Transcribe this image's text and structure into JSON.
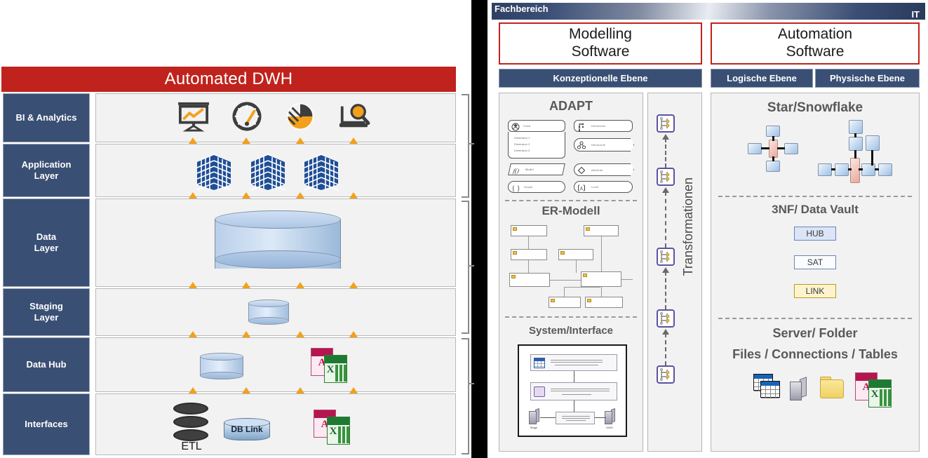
{
  "left_panel": {
    "title": "Automated DWH",
    "title_color": "#c0231d",
    "layer_color": "#3a4f74",
    "layers": [
      {
        "label": "BI & Analytics"
      },
      {
        "label": "Application\nLayer",
        "line1": "Application",
        "line2": "Layer"
      },
      {
        "label": "Data\nLayer",
        "line1": "Data",
        "line2": "Layer"
      },
      {
        "label": "Staging\nLayer",
        "line1": "Staging",
        "line2": "Layer"
      },
      {
        "label": "Data Hub"
      },
      {
        "label": "Interfaces"
      }
    ],
    "bi_icons": [
      "presentation-chart-icon",
      "speedometer-icon",
      "pie-chart-icon",
      "laptop-search-icon"
    ],
    "application_icons": [
      "building-cube-icon",
      "building-cube-icon",
      "building-cube-icon"
    ],
    "data_layer_icons": [
      "database-cylinder-large-icon"
    ],
    "staging_icons": [
      "database-cylinder-small-icon"
    ],
    "data_hub_icons": [
      "database-cylinder-small-icon",
      "access-excel-files-icon"
    ],
    "interfaces": {
      "etl_label": "ETL",
      "db_link_label": "DB Link",
      "icons": [
        "etl-stack-icon",
        "db-link-cylinder-icon",
        "access-excel-files-icon"
      ]
    },
    "braces": [
      "brace-top",
      "brace-middle",
      "brace-bottom"
    ]
  },
  "right_panel": {
    "header": {
      "left_label": "Fachbereich",
      "right_label": "IT"
    },
    "software": [
      {
        "line1": "Modelling",
        "line2": "Software"
      },
      {
        "line1": "Automation",
        "line2": "Software"
      }
    ],
    "ebenen": [
      {
        "label": "Konzeptionelle Ebene"
      },
      {
        "label": "Logische Ebene"
      },
      {
        "label": "Physische Ebene"
      }
    ],
    "conceptual": {
      "adapt": {
        "title": "ADAPT",
        "cube": {
          "label": "Cube",
          "dims": [
            "Dimension 1",
            "Dimension 2",
            "Dimension 3"
          ]
        },
        "items": [
          {
            "label": "Dimension",
            "icon": "dimension-icon"
          },
          {
            "label": "Hierarchie",
            "icon": "hierarchy-icon"
          },
          {
            "label": "Model",
            "icon": "model-icon"
          },
          {
            "label": "Attribute",
            "icon": "attribute-icon"
          },
          {
            "label": "Scope",
            "icon": "scope-icon"
          },
          {
            "label": "Level",
            "icon": "level-icon"
          }
        ]
      },
      "er": {
        "title": "ER-Modell"
      },
      "system": {
        "title": "System/Interface",
        "stage_label": "Stage",
        "dwh_label": "DWH",
        "link_label": "Stage -> DWH"
      }
    },
    "transformation": {
      "title": "Transformationen",
      "step_count": 5,
      "icon": "transformation-flow-icon",
      "accent": "#5b53a0"
    },
    "physical": {
      "star": {
        "title": "Star/Snowflake",
        "star_dims": 4,
        "snowflake_dims": 7
      },
      "vault": {
        "title": "3NF/ Data Vault",
        "entities": [
          {
            "label": "HUB",
            "color": "#dbe5f7"
          },
          {
            "label": "SAT",
            "color": "#fbfcff"
          },
          {
            "label": "LINK",
            "color": "#fdf4cf"
          }
        ]
      },
      "server": {
        "line1": "Server/ Folder",
        "line2": "Files / Connections / Tables",
        "icons": [
          "tables-icon",
          "server-icon",
          "folder-icon",
          "access-excel-files-icon"
        ]
      }
    }
  }
}
